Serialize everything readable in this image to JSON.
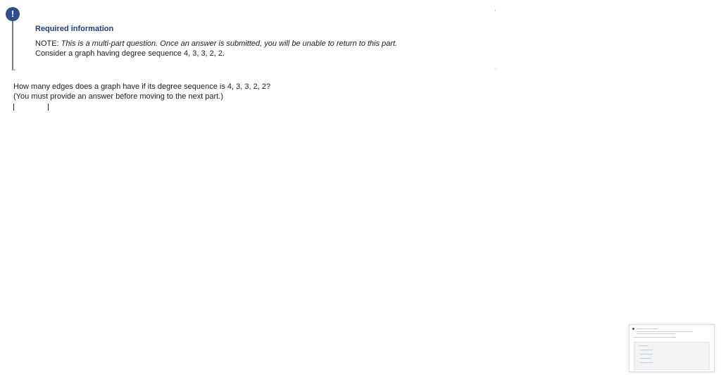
{
  "required_info": {
    "icon": "!",
    "title": "Required information",
    "note_prefix": "NOTE: ",
    "note_text": "This is a multi-part question. Once an answer is submitted, you will be unable to return to this part.",
    "context": "Consider a graph having degree sequence 4, 3, 3, 2, 2."
  },
  "question": {
    "text": "How many edges does a graph have if its degree sequence is 4, 3, 3, 2, 2?",
    "instruction": "(You must provide an answer before moving to the next part.)",
    "answer_value": ""
  },
  "colors": {
    "accent": "#2e4f8b",
    "title": "#1f3d7a"
  }
}
